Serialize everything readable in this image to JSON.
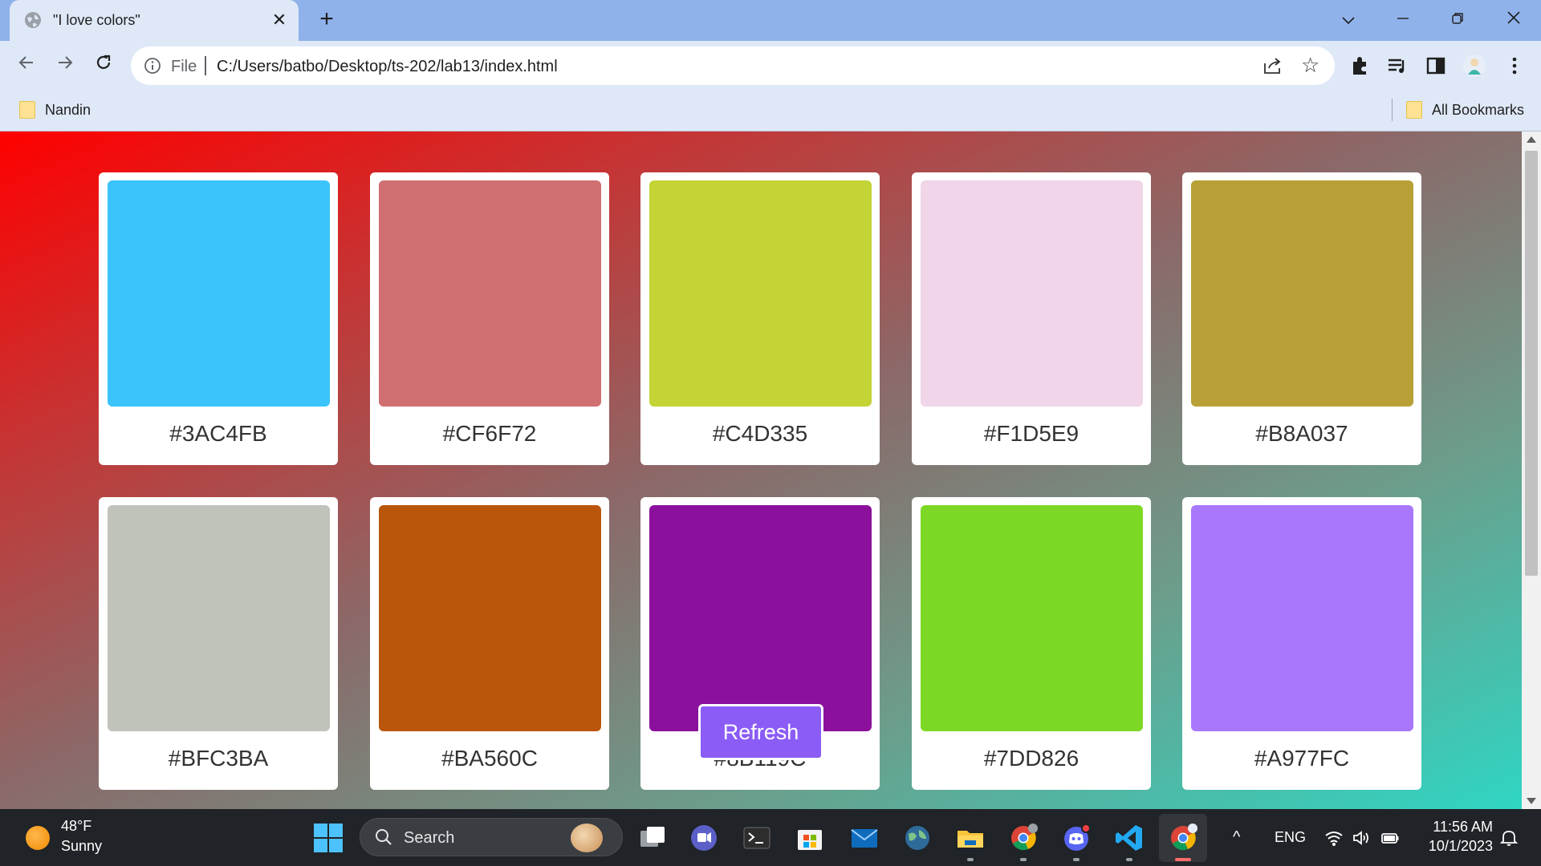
{
  "browser": {
    "tab_title": "\"I love colors\"",
    "scheme_label": "File",
    "url": "C:/Users/batbo/Desktop/ts-202/lab13/index.html",
    "bookmarks": [
      {
        "label": "Nandin"
      }
    ],
    "all_bookmarks_label": "All Bookmarks"
  },
  "palette": {
    "cards": [
      {
        "hex": "#3AC4FB",
        "color": "#3AC4FB"
      },
      {
        "hex": "#CF6F72",
        "color": "#CF6F72"
      },
      {
        "hex": "#C4D335",
        "color": "#C4D335"
      },
      {
        "hex": "#F1D5E9",
        "color": "#F1D5E9"
      },
      {
        "hex": "#B8A037",
        "color": "#B8A037"
      },
      {
        "hex": "#BFC3BA",
        "color": "#BFC3BA"
      },
      {
        "hex": "#BA560C",
        "color": "#BA560C"
      },
      {
        "hex": "#8B119C",
        "color": "#8B119C"
      },
      {
        "hex": "#7DD826",
        "color": "#7DD826"
      },
      {
        "hex": "#A977FC",
        "color": "#A977FC"
      }
    ],
    "refresh_label": "Refresh",
    "refresh_color": "#8B5CF6"
  },
  "taskbar": {
    "weather_temp": "48°F",
    "weather_condition": "Sunny",
    "search_label": "Search",
    "language": "ENG",
    "time": "11:56 AM",
    "date": "10/1/2023"
  }
}
